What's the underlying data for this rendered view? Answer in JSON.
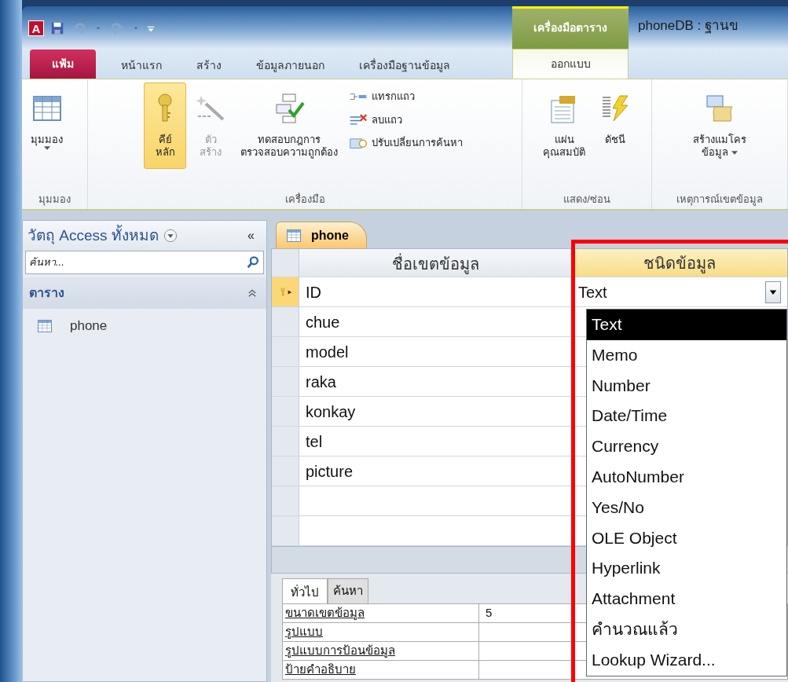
{
  "app_logo": "A",
  "context_tab_group": "เครื่องมือตาราง",
  "window": {
    "title": "phoneDB : ฐานข"
  },
  "ribbon_tabs": [
    {
      "label": "แฟ้ม",
      "kind": "file",
      "selected": false
    },
    {
      "label": "หน้าแรก",
      "kind": "normal",
      "selected": false
    },
    {
      "label": "สร้าง",
      "kind": "normal",
      "selected": false
    },
    {
      "label": "ข้อมูลภายนอก",
      "kind": "normal",
      "selected": false
    },
    {
      "label": "เครื่องมือฐานข้อมูล",
      "kind": "normal",
      "selected": false
    },
    {
      "label": "ออกแบบ",
      "kind": "contextual",
      "selected": true
    }
  ],
  "ribbon_groups": [
    {
      "label": "มุมมอง",
      "commands": [
        {
          "label": "มุมมอง",
          "kind": "large",
          "dropdown": true,
          "selected": false,
          "disabled": false
        }
      ]
    },
    {
      "label": "เครื่องมือ",
      "commands": [
        {
          "label": "คีย์\nหลัก",
          "kind": "large",
          "selected": true,
          "disabled": false
        },
        {
          "label": "ตัว\nสร้าง",
          "kind": "large",
          "selected": false,
          "disabled": true
        },
        {
          "label": "ทดสอบกฎการ\nตรวจสอบความถูกต้อง",
          "kind": "large",
          "selected": false,
          "disabled": false
        },
        {
          "label": "แทรกแถว",
          "kind": "small",
          "selected": false,
          "disabled": false
        },
        {
          "label": "ลบแถว",
          "kind": "small",
          "selected": false,
          "disabled": false
        },
        {
          "label": "ปรับเปลี่ยนการค้นหา",
          "kind": "small",
          "selected": false,
          "disabled": false
        }
      ]
    },
    {
      "label": "แสดง/ซ่อน",
      "commands": [
        {
          "label": "แผ่น\nคุณสมบัติ",
          "kind": "large",
          "selected": false,
          "disabled": false
        },
        {
          "label": "ดัชนี",
          "kind": "large",
          "selected": false,
          "disabled": false
        }
      ]
    },
    {
      "label": "เหตุการณ์เขตข้อมูล",
      "commands": [
        {
          "label": "สร้างแมโคร\nข้อมูล",
          "kind": "large",
          "dropdown": true,
          "selected": false,
          "disabled": false
        }
      ]
    }
  ],
  "nav_pane": {
    "title": "วัตถุ Access ทั้งหมด",
    "collapse": "«",
    "search": {
      "placeholder": "ค้นหา..."
    },
    "groups": [
      {
        "label": "ตาราง",
        "expanded": true,
        "items": [
          {
            "label": "phone",
            "selected": false
          }
        ]
      }
    ]
  },
  "document_tabs": [
    {
      "label": "phone",
      "selected": true
    }
  ],
  "field_grid": {
    "columns": [
      "ชื่อเขตข้อมูล",
      "ชนิดข้อมูล"
    ],
    "rows": [
      {
        "name": "ID",
        "type": "Text",
        "primary_key": true,
        "selected": true
      },
      {
        "name": "chue",
        "primary_key": false,
        "selected": false
      },
      {
        "name": "model",
        "primary_key": false,
        "selected": false
      },
      {
        "name": "raka",
        "primary_key": false,
        "selected": false
      },
      {
        "name": "konkay",
        "primary_key": false,
        "selected": false
      },
      {
        "name": "tel",
        "primary_key": false,
        "selected": false
      },
      {
        "name": "picture",
        "primary_key": false,
        "selected": false
      }
    ]
  },
  "type_dropdown": {
    "options": [
      {
        "label": "Text",
        "selected": true
      },
      {
        "label": "Memo",
        "selected": false
      },
      {
        "label": "Number",
        "selected": false
      },
      {
        "label": "Date/Time",
        "selected": false
      },
      {
        "label": "Currency",
        "selected": false
      },
      {
        "label": "AutoNumber",
        "selected": false
      },
      {
        "label": "Yes/No",
        "selected": false
      },
      {
        "label": "OLE Object",
        "selected": false
      },
      {
        "label": "Hyperlink",
        "selected": false
      },
      {
        "label": "Attachment",
        "selected": false
      },
      {
        "label": "คำนวณแล้ว",
        "selected": false
      },
      {
        "label": "Lookup Wizard...",
        "selected": false
      }
    ]
  },
  "field_properties": {
    "tabs": [
      {
        "label": "ทั่วไป",
        "selected": true
      },
      {
        "label": "ค้นหา",
        "selected": false
      }
    ],
    "rows": [
      {
        "label": "ขนาดเขตข้อมูล",
        "value": "5"
      },
      {
        "label": "รูปแบบ"
      },
      {
        "label": "รูปแบบการป้อนข้อมูล"
      },
      {
        "label": "ป้ายคำอธิบาย"
      }
    ]
  }
}
